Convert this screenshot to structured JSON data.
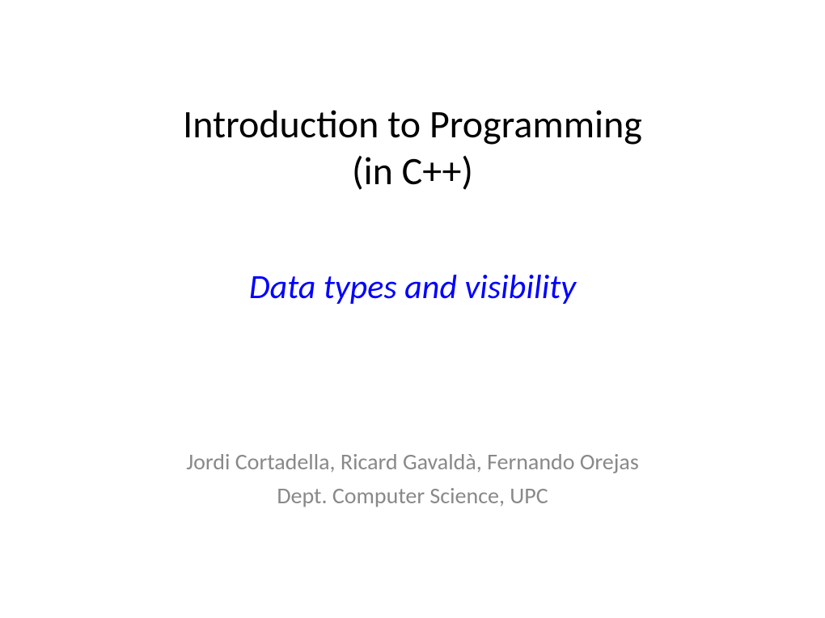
{
  "title_line1": "Introduction to Programming",
  "title_line2": "(in C++)",
  "subtitle": "Data types and visibility",
  "authors_line1": "Jordi Cortadella, Ricard Gavaldà, Fernando Orejas",
  "authors_line2": "Dept. Computer Science, UPC"
}
